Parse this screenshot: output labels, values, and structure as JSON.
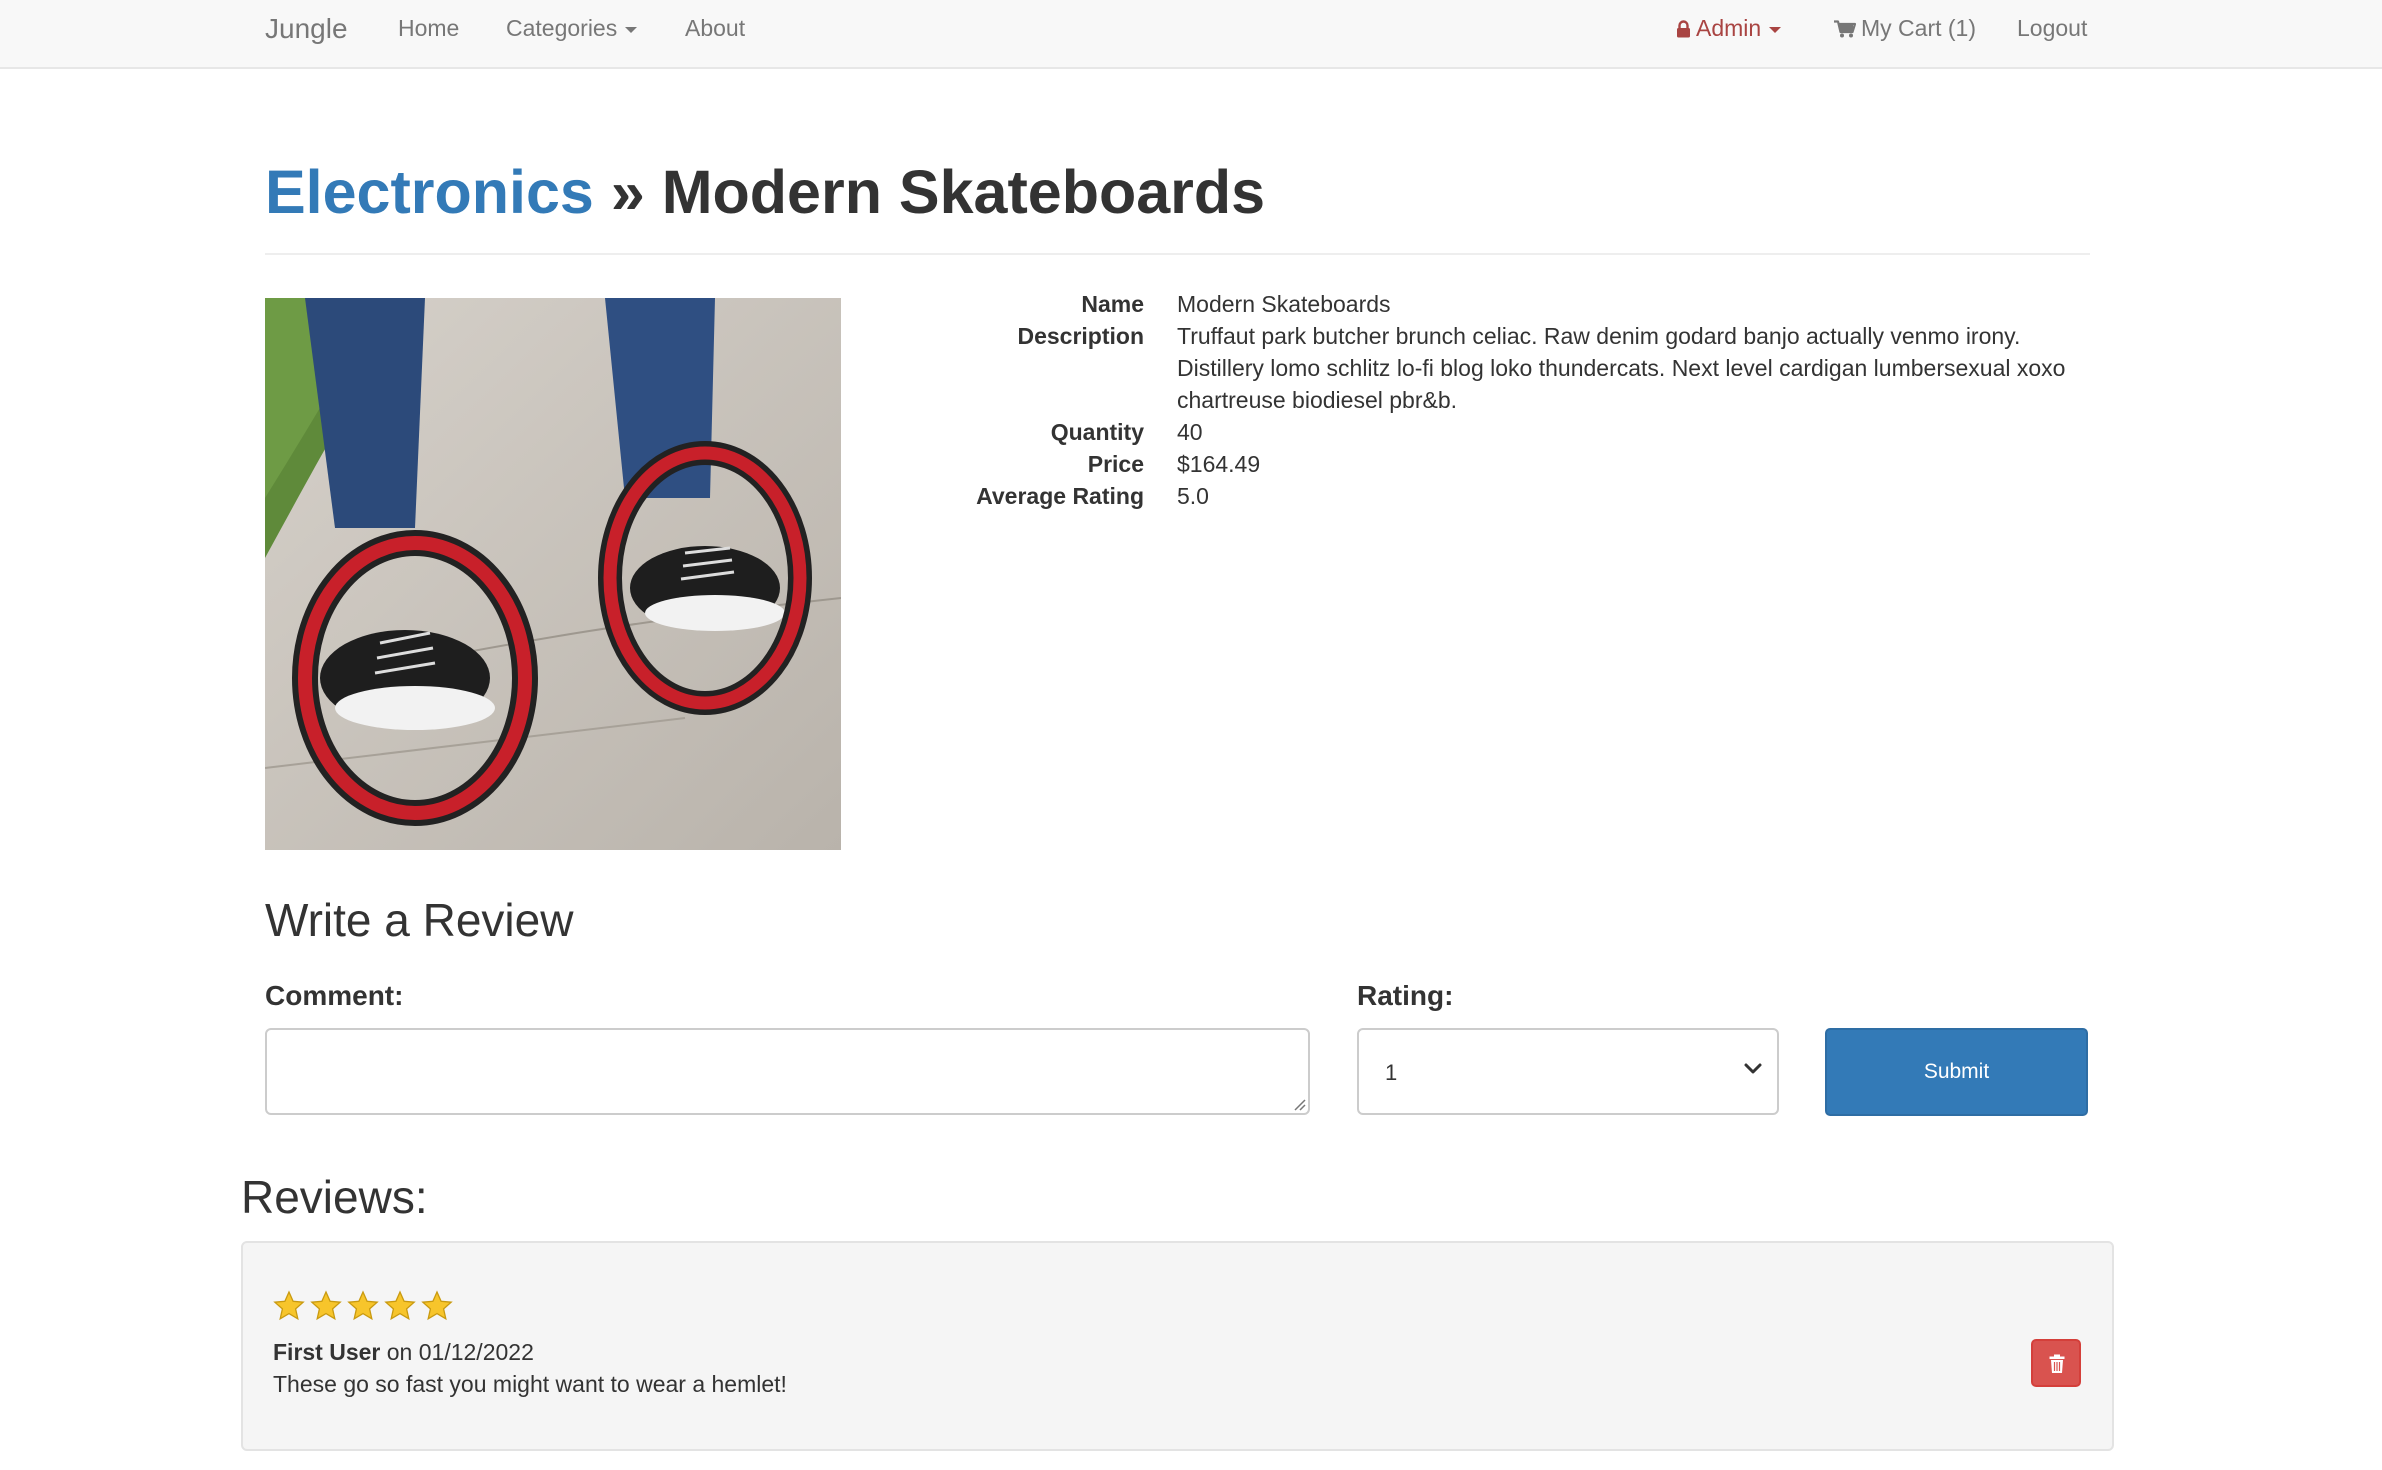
{
  "navbar": {
    "brand": "Jungle",
    "home": "Home",
    "categories": "Categories",
    "about": "About",
    "admin": "Admin",
    "cart": "My Cart (1)",
    "logout": "Logout",
    "icons": {
      "admin": "lock-icon",
      "cart": "shopping-cart-icon"
    }
  },
  "breadcrumb": {
    "category": "Electronics",
    "separator": "»",
    "product": "Modern Skateboards"
  },
  "product": {
    "image": "skateboard-wheels-photo",
    "fields": {
      "name_label": "Name",
      "name": "Modern Skateboards",
      "description_label": "Description",
      "description": "Truffaut park butcher brunch celiac. Raw denim godard banjo actually venmo irony. Distillery lomo schlitz lo-fi blog loko thundercats. Next level cardigan lumbersexual xoxo chartreuse biodiesel pbr&b.",
      "quantity_label": "Quantity",
      "quantity": "40",
      "price_label": "Price",
      "price": "$164.49",
      "rating_label": "Average Rating",
      "rating": "5.0"
    }
  },
  "review_form": {
    "title": "Write a Review",
    "comment_label": "Comment:",
    "comment_value": "",
    "rating_label": "Rating:",
    "rating_selected": "1",
    "submit_label": "Submit"
  },
  "reviews": {
    "title": "Reviews:",
    "items": [
      {
        "stars": 5,
        "author": "First User",
        "on": "on",
        "date": "01/12/2022",
        "text": "These go so fast you might want to wear a hemlet!",
        "delete_icon": "trash-icon"
      }
    ]
  },
  "colors": {
    "link": "#337ab7",
    "admin": "#a94442",
    "primary_button": "#337ab7",
    "danger_button": "#d9534f",
    "navbar_bg": "#f8f8f8"
  }
}
